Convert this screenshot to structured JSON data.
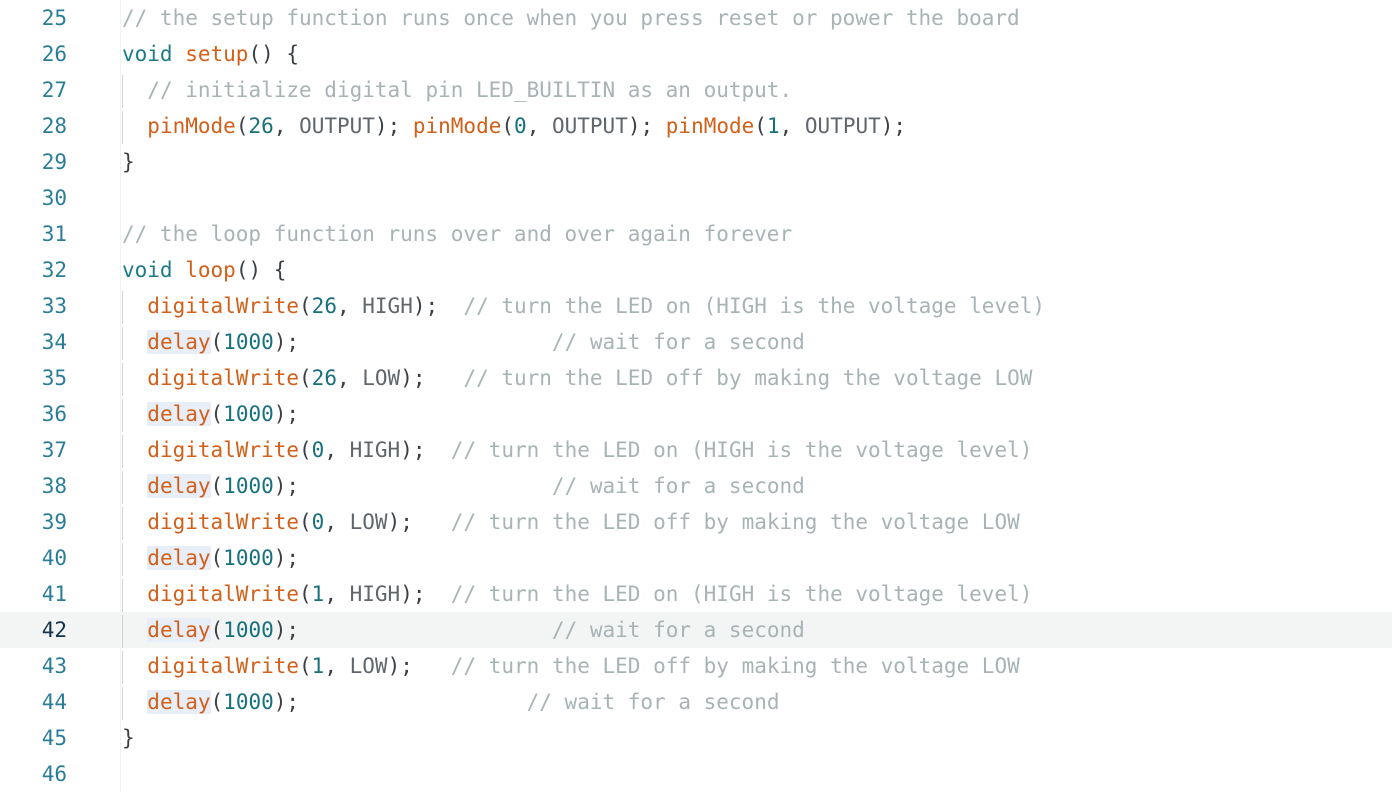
{
  "editor": {
    "language": "arduino-cpp",
    "active_line": 42,
    "first_visible_line": 25,
    "last_visible_line": 46,
    "colors": {
      "background": "#ffffff",
      "active_line_background": "#f3f4f4",
      "gutter_number": "#2b7d97",
      "gutter_number_active": "#11344c",
      "comment": "#a8b3b5",
      "keyword": "#1c7b84",
      "function": "#d2601a",
      "number": "#17707a",
      "constant": "#60666b",
      "punctuation": "#3b4045",
      "occurrence_highlight": "#e8eef7",
      "indent_guide": "#cfd3d6"
    },
    "highlighted_symbol": "delay"
  },
  "lines": [
    {
      "number": "25",
      "active": false,
      "indent": 0,
      "indent_guide": false,
      "tokens": [
        {
          "t": "comment",
          "s": "// the setup function runs once when you press reset or power the board"
        }
      ]
    },
    {
      "number": "26",
      "active": false,
      "indent": 0,
      "indent_guide": false,
      "tokens": [
        {
          "t": "keyword",
          "s": "void"
        },
        {
          "t": "plain",
          "s": " "
        },
        {
          "t": "func",
          "s": "setup"
        },
        {
          "t": "punct",
          "s": "() {"
        }
      ]
    },
    {
      "number": "27",
      "active": false,
      "indent": 2,
      "indent_guide": true,
      "tokens": [
        {
          "t": "plain",
          "s": "  "
        },
        {
          "t": "comment",
          "s": "// initialize digital pin LED_BUILTIN as an output."
        }
      ]
    },
    {
      "number": "28",
      "active": false,
      "indent": 2,
      "indent_guide": true,
      "tokens": [
        {
          "t": "plain",
          "s": "  "
        },
        {
          "t": "func",
          "s": "pinMode"
        },
        {
          "t": "punct",
          "s": "("
        },
        {
          "t": "number",
          "s": "26"
        },
        {
          "t": "punct",
          "s": ", "
        },
        {
          "t": "const",
          "s": "OUTPUT"
        },
        {
          "t": "punct",
          "s": "); "
        },
        {
          "t": "func",
          "s": "pinMode"
        },
        {
          "t": "punct",
          "s": "("
        },
        {
          "t": "number",
          "s": "0"
        },
        {
          "t": "punct",
          "s": ", "
        },
        {
          "t": "const",
          "s": "OUTPUT"
        },
        {
          "t": "punct",
          "s": "); "
        },
        {
          "t": "func",
          "s": "pinMode"
        },
        {
          "t": "punct",
          "s": "("
        },
        {
          "t": "number",
          "s": "1"
        },
        {
          "t": "punct",
          "s": ", "
        },
        {
          "t": "const",
          "s": "OUTPUT"
        },
        {
          "t": "punct",
          "s": ");"
        }
      ]
    },
    {
      "number": "29",
      "active": false,
      "indent": 0,
      "indent_guide": false,
      "tokens": [
        {
          "t": "punct",
          "s": "}"
        }
      ]
    },
    {
      "number": "30",
      "active": false,
      "indent": 0,
      "indent_guide": false,
      "tokens": []
    },
    {
      "number": "31",
      "active": false,
      "indent": 0,
      "indent_guide": false,
      "tokens": [
        {
          "t": "comment",
          "s": "// the loop function runs over and over again forever"
        }
      ]
    },
    {
      "number": "32",
      "active": false,
      "indent": 0,
      "indent_guide": false,
      "tokens": [
        {
          "t": "keyword",
          "s": "void"
        },
        {
          "t": "plain",
          "s": " "
        },
        {
          "t": "func",
          "s": "loop"
        },
        {
          "t": "punct",
          "s": "() {"
        }
      ]
    },
    {
      "number": "33",
      "active": false,
      "indent": 2,
      "indent_guide": true,
      "tokens": [
        {
          "t": "plain",
          "s": "  "
        },
        {
          "t": "func",
          "s": "digitalWrite"
        },
        {
          "t": "punct",
          "s": "("
        },
        {
          "t": "number",
          "s": "26"
        },
        {
          "t": "punct",
          "s": ", "
        },
        {
          "t": "const",
          "s": "HIGH"
        },
        {
          "t": "punct",
          "s": ");"
        },
        {
          "t": "plain",
          "s": "  "
        },
        {
          "t": "comment",
          "s": "// turn the LED on (HIGH is the voltage level)"
        }
      ]
    },
    {
      "number": "34",
      "active": false,
      "indent": 2,
      "indent_guide": true,
      "tokens": [
        {
          "t": "plain",
          "s": "  "
        },
        {
          "t": "func",
          "s": "delay",
          "occurrence": true
        },
        {
          "t": "punct",
          "s": "("
        },
        {
          "t": "number",
          "s": "1000"
        },
        {
          "t": "punct",
          "s": ");"
        },
        {
          "t": "plain",
          "s": "                    "
        },
        {
          "t": "comment",
          "s": "// wait for a second"
        }
      ]
    },
    {
      "number": "35",
      "active": false,
      "indent": 2,
      "indent_guide": true,
      "tokens": [
        {
          "t": "plain",
          "s": "  "
        },
        {
          "t": "func",
          "s": "digitalWrite"
        },
        {
          "t": "punct",
          "s": "("
        },
        {
          "t": "number",
          "s": "26"
        },
        {
          "t": "punct",
          "s": ", "
        },
        {
          "t": "const",
          "s": "LOW"
        },
        {
          "t": "punct",
          "s": ");"
        },
        {
          "t": "plain",
          "s": "   "
        },
        {
          "t": "comment",
          "s": "// turn the LED off by making the voltage LOW"
        }
      ]
    },
    {
      "number": "36",
      "active": false,
      "indent": 2,
      "indent_guide": true,
      "tokens": [
        {
          "t": "plain",
          "s": "  "
        },
        {
          "t": "func",
          "s": "delay",
          "occurrence": true
        },
        {
          "t": "punct",
          "s": "("
        },
        {
          "t": "number",
          "s": "1000"
        },
        {
          "t": "punct",
          "s": ");"
        }
      ]
    },
    {
      "number": "37",
      "active": false,
      "indent": 2,
      "indent_guide": true,
      "tokens": [
        {
          "t": "plain",
          "s": "  "
        },
        {
          "t": "func",
          "s": "digitalWrite"
        },
        {
          "t": "punct",
          "s": "("
        },
        {
          "t": "number",
          "s": "0"
        },
        {
          "t": "punct",
          "s": ", "
        },
        {
          "t": "const",
          "s": "HIGH"
        },
        {
          "t": "punct",
          "s": ");"
        },
        {
          "t": "plain",
          "s": "  "
        },
        {
          "t": "comment",
          "s": "// turn the LED on (HIGH is the voltage level)"
        }
      ]
    },
    {
      "number": "38",
      "active": false,
      "indent": 2,
      "indent_guide": true,
      "tokens": [
        {
          "t": "plain",
          "s": "  "
        },
        {
          "t": "func",
          "s": "delay",
          "occurrence": true
        },
        {
          "t": "punct",
          "s": "("
        },
        {
          "t": "number",
          "s": "1000"
        },
        {
          "t": "punct",
          "s": ");"
        },
        {
          "t": "plain",
          "s": "                    "
        },
        {
          "t": "comment",
          "s": "// wait for a second"
        }
      ]
    },
    {
      "number": "39",
      "active": false,
      "indent": 2,
      "indent_guide": true,
      "tokens": [
        {
          "t": "plain",
          "s": "  "
        },
        {
          "t": "func",
          "s": "digitalWrite"
        },
        {
          "t": "punct",
          "s": "("
        },
        {
          "t": "number",
          "s": "0"
        },
        {
          "t": "punct",
          "s": ", "
        },
        {
          "t": "const",
          "s": "LOW"
        },
        {
          "t": "punct",
          "s": ");"
        },
        {
          "t": "plain",
          "s": "   "
        },
        {
          "t": "comment",
          "s": "// turn the LED off by making the voltage LOW"
        }
      ]
    },
    {
      "number": "40",
      "active": false,
      "indent": 2,
      "indent_guide": true,
      "tokens": [
        {
          "t": "plain",
          "s": "  "
        },
        {
          "t": "func",
          "s": "delay",
          "occurrence": true
        },
        {
          "t": "punct",
          "s": "("
        },
        {
          "t": "number",
          "s": "1000"
        },
        {
          "t": "punct",
          "s": ");"
        }
      ]
    },
    {
      "number": "41",
      "active": false,
      "indent": 2,
      "indent_guide": true,
      "tokens": [
        {
          "t": "plain",
          "s": "  "
        },
        {
          "t": "func",
          "s": "digitalWrite"
        },
        {
          "t": "punct",
          "s": "("
        },
        {
          "t": "number",
          "s": "1"
        },
        {
          "t": "punct",
          "s": ", "
        },
        {
          "t": "const",
          "s": "HIGH"
        },
        {
          "t": "punct",
          "s": ");"
        },
        {
          "t": "plain",
          "s": "  "
        },
        {
          "t": "comment",
          "s": "// turn the LED on (HIGH is the voltage level)"
        }
      ]
    },
    {
      "number": "42",
      "active": true,
      "indent": 2,
      "indent_guide": true,
      "tokens": [
        {
          "t": "plain",
          "s": "  "
        },
        {
          "t": "func",
          "s": "delay",
          "occurrence": true
        },
        {
          "t": "punct",
          "s": "("
        },
        {
          "t": "number",
          "s": "1000"
        },
        {
          "t": "punct",
          "s": ");"
        },
        {
          "t": "plain",
          "s": "                    "
        },
        {
          "t": "comment",
          "s": "// wait for a second"
        }
      ]
    },
    {
      "number": "43",
      "active": false,
      "indent": 2,
      "indent_guide": true,
      "tokens": [
        {
          "t": "plain",
          "s": "  "
        },
        {
          "t": "func",
          "s": "digitalWrite"
        },
        {
          "t": "punct",
          "s": "("
        },
        {
          "t": "number",
          "s": "1"
        },
        {
          "t": "punct",
          "s": ", "
        },
        {
          "t": "const",
          "s": "LOW"
        },
        {
          "t": "punct",
          "s": ");"
        },
        {
          "t": "plain",
          "s": "   "
        },
        {
          "t": "comment",
          "s": "// turn the LED off by making the voltage LOW"
        }
      ]
    },
    {
      "number": "44",
      "active": false,
      "indent": 2,
      "indent_guide": true,
      "tokens": [
        {
          "t": "plain",
          "s": "  "
        },
        {
          "t": "func",
          "s": "delay",
          "occurrence": true
        },
        {
          "t": "punct",
          "s": "("
        },
        {
          "t": "number",
          "s": "1000"
        },
        {
          "t": "punct",
          "s": ");"
        },
        {
          "t": "plain",
          "s": "                  "
        },
        {
          "t": "comment",
          "s": "// wait for a second"
        }
      ]
    },
    {
      "number": "45",
      "active": false,
      "indent": 0,
      "indent_guide": false,
      "tokens": [
        {
          "t": "punct",
          "s": "}"
        }
      ]
    },
    {
      "number": "46",
      "active": false,
      "indent": 0,
      "indent_guide": false,
      "tokens": []
    }
  ]
}
